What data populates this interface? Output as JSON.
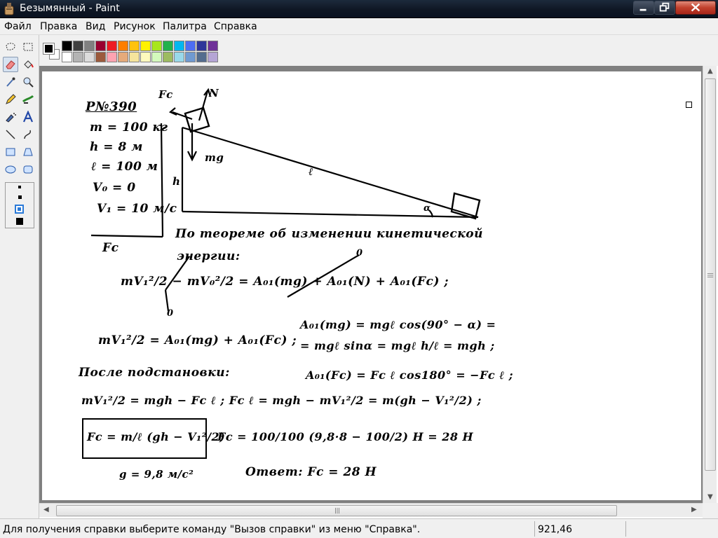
{
  "window": {
    "title": "Безымянный - Paint"
  },
  "menu": {
    "items": [
      "Файл",
      "Правка",
      "Вид",
      "Рисунок",
      "Палитра",
      "Справка"
    ]
  },
  "palette": {
    "foreground": "#000000",
    "background": "#ffffff",
    "row1": [
      "#000000",
      "#404040",
      "#808080",
      "#990030",
      "#ed1c24",
      "#ff7e00",
      "#ffc20e",
      "#fff200",
      "#a8e61d",
      "#22b14c",
      "#00b7ef",
      "#4d6df3",
      "#2f3699",
      "#6f3198"
    ],
    "row2": [
      "#ffffff",
      "#b4b4b4",
      "#dcdcdc",
      "#9c5a3c",
      "#ffa3b1",
      "#e5aa7a",
      "#f5e49c",
      "#fff9bd",
      "#d3f9bc",
      "#9dbb61",
      "#99d9ea",
      "#709ad1",
      "#546d8e",
      "#b5a5d5"
    ]
  },
  "tools": {
    "active": "eraser-tool",
    "icons": [
      "free-select-icon",
      "rect-select-icon",
      "eraser-icon",
      "fill-icon",
      "picker-icon",
      "magnifier-icon",
      "pencil-icon",
      "brush-icon",
      "airbrush-icon",
      "text-icon",
      "line-icon",
      "curve-icon",
      "rectangle-icon",
      "polygon-icon",
      "ellipse-icon",
      "rounded-rect-icon"
    ]
  },
  "drawing": {
    "header": "Р№390",
    "given": [
      "m = 100 кг",
      "h = 8 м",
      "ℓ = 100 м",
      "V₀ = 0",
      "V₁ = 10 м/с"
    ],
    "find": "Fc",
    "labels": {
      "fc": "Fc",
      "n": "N",
      "mg": "mg",
      "h": "h",
      "l": "ℓ",
      "alpha": "α"
    },
    "lines": [
      "По теореме об изменении кинетической",
      "энергии:",
      "mV₁²/2 − mV₀²/2 = A₀₁(mg) + A₀₁(N) + A₀₁(Fc) ;",
      "0",
      "0",
      "mV₁²/2 = A₀₁(mg) + A₀₁(Fc) ;",
      "A₀₁(mg) = mgℓ cos(90° − α) =",
      "= mgℓ sinα = mgℓ h/ℓ = mgh ;",
      "После подстановки:",
      "A₀₁(Fc) = Fc ℓ cos180° = −Fc ℓ ;",
      "mV₁²/2 = mgh − Fc ℓ ;   Fc ℓ = mgh − mV₁²/2 = m(gh − V₁²/2) ;",
      "Fc = m/ℓ (gh − V₁²/2)",
      "Fc = 100/100 (9,8·8 − 100/2) H = 28 H",
      "g = 9,8 м/с²",
      "Ответ: Fc = 28 H"
    ]
  },
  "status": {
    "text": "Для получения справки выберите команду \"Вызов справки\" из меню \"Справка\".",
    "coords": "921,46"
  }
}
